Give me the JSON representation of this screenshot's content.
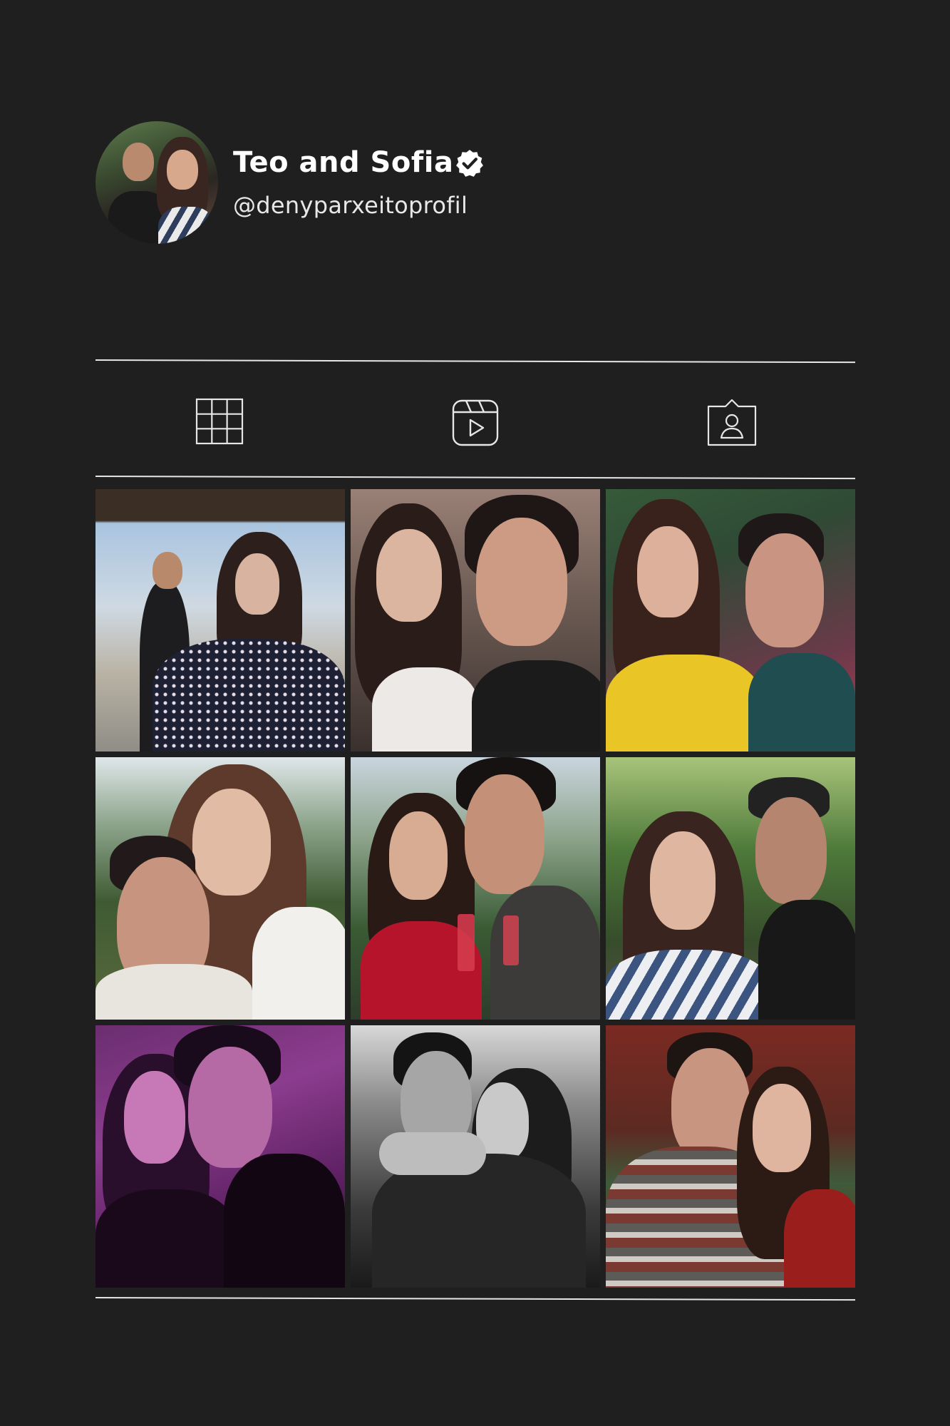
{
  "profile": {
    "display_name": "Teo and Sofia",
    "handle": "@denyparxeitoprofil",
    "verified": true
  },
  "tabs": [
    {
      "name": "posts",
      "icon": "grid-icon",
      "active": true
    },
    {
      "name": "reels",
      "icon": "reels-icon",
      "active": false
    },
    {
      "name": "tagged",
      "icon": "tagged-user-icon",
      "active": false
    }
  ],
  "colors": {
    "background": "#1f1f1f",
    "text": "#ffffff",
    "divider": "#e6e6e6"
  },
  "posts": [
    {
      "row": 1,
      "col": 1,
      "scene": "outdoor-sunny-street"
    },
    {
      "row": 1,
      "col": 2,
      "scene": "selfie-stone-wall"
    },
    {
      "row": 1,
      "col": 3,
      "scene": "selfie-festival"
    },
    {
      "row": 2,
      "col": 1,
      "scene": "hug-forest-sunset"
    },
    {
      "row": 2,
      "col": 2,
      "scene": "toast-wine-glasses"
    },
    {
      "row": 2,
      "col": 3,
      "scene": "selfie-forest"
    },
    {
      "row": 3,
      "col": 1,
      "scene": "selfie-purple-light"
    },
    {
      "row": 3,
      "col": 2,
      "scene": "kiss-black-white"
    },
    {
      "row": 3,
      "col": 3,
      "scene": "selfie-restaurant"
    }
  ]
}
